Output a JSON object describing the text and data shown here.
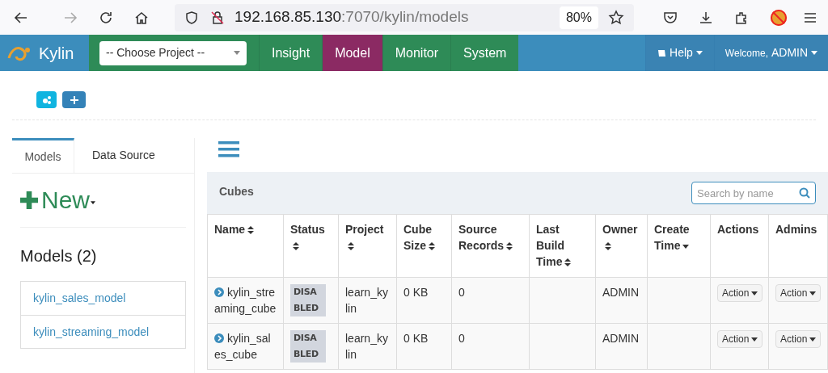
{
  "browser": {
    "url_host": "192.168.85.130",
    "url_rest": ":7070/kylin/models",
    "zoom": "80%"
  },
  "navbar": {
    "brand": "Kylin",
    "project_select": "-- Choose Project --",
    "tabs": [
      {
        "label": "Insight",
        "selected": false
      },
      {
        "label": "Model",
        "selected": true
      },
      {
        "label": "Monitor",
        "selected": false
      },
      {
        "label": "System",
        "selected": false
      }
    ],
    "help": "Help",
    "welcome": "Welcome,",
    "user": "ADMIN"
  },
  "sidebar": {
    "tabs": [
      {
        "label": "Models",
        "selected": true
      },
      {
        "label": "Data Source",
        "selected": false
      }
    ],
    "new_button": "New",
    "models_heading": "Models (2)",
    "models": [
      "kylin_sales_model",
      "kylin_streaming_model"
    ]
  },
  "cubes": {
    "title": "Cubes",
    "search_placeholder": "Search by name",
    "columns": [
      {
        "label": "Name",
        "sortable": true,
        "sorted_descending": false
      },
      {
        "label": "Status",
        "sortable": true,
        "sorted_descending": false
      },
      {
        "label": "Project",
        "sortable": true,
        "sorted_descending": false
      },
      {
        "label": "Cube Size",
        "sortable": true,
        "sorted_descending": false
      },
      {
        "label": "Source Records",
        "sortable": true,
        "sorted_descending": false
      },
      {
        "label": "Last Build Time",
        "sortable": true,
        "sorted_descending": false
      },
      {
        "label": "Owner",
        "sortable": true,
        "sorted_descending": false
      },
      {
        "label": "Create Time",
        "sortable": true,
        "sorted_descending": true
      },
      {
        "label": "Actions",
        "sortable": false,
        "sorted_descending": false
      },
      {
        "label": "Admins",
        "sortable": false,
        "sorted_descending": false
      }
    ],
    "rows": [
      {
        "name": "kylin_streaming_cube",
        "status": "DISABLED",
        "project": "learn_kylin",
        "size": "0 KB",
        "records": "0",
        "owner": "ADMIN",
        "action": "Action",
        "admin": "Action"
      },
      {
        "name": "kylin_sales_cube",
        "status": "DISABLED",
        "project": "learn_kylin",
        "size": "0 KB",
        "records": "0",
        "owner": "ADMIN",
        "action": "Action",
        "admin": "Action"
      }
    ]
  }
}
